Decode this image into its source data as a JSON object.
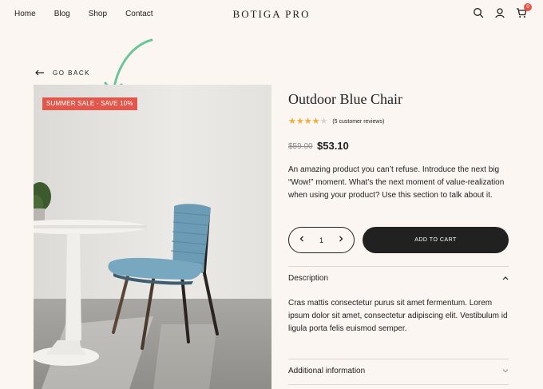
{
  "nav": {
    "items": [
      "Home",
      "Blog",
      "Shop",
      "Contact"
    ]
  },
  "logo": "BOTIGA PRO",
  "header": {
    "icons": [
      "search-icon",
      "user-icon",
      "cart-icon"
    ],
    "cart_count": "0"
  },
  "go_back": "GO BACK",
  "sale_badge": "SUMMER SALE - SAVE 10%",
  "product": {
    "title": "Outdoor Blue Chair",
    "rating": 4,
    "rating_max": 5,
    "reviews": "(5 customer reviews)",
    "price_old": "$59.00",
    "price_new": "$53.10",
    "description": "An amazing product you can’t refuse. Introduce the next big “Wow!” moment. What’s the next moment of value-realization when using your product? Use this section to talk about it.",
    "quantity": "1",
    "add_to_cart": "ADD TO CART"
  },
  "accordion": {
    "description_title": "Description",
    "description_body": "Cras mattis consectetur purus sit amet fermentum. Lorem ipsum dolor sit amet, consectetur adipiscing elit. Vestibulum id ligula porta felis euismod semper.",
    "additional_title": "Additional information"
  },
  "colors": {
    "background": "#fbf6f2",
    "accent": "#e2574c",
    "dark": "#212121",
    "star": "#f0b13a",
    "annotation": "#6cc59a"
  }
}
